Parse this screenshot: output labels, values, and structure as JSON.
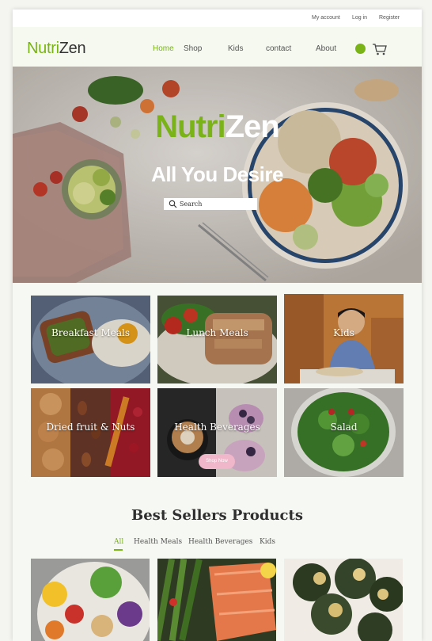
{
  "topbar": {
    "my_account": "My account",
    "login": "Log in",
    "register": "Register"
  },
  "brand": {
    "part1": "Nutri",
    "part2": "Zen"
  },
  "nav": {
    "home": "Home",
    "shop": "Shop",
    "kids": "Kids",
    "contact": "contact",
    "about": "About"
  },
  "hero": {
    "title_part1": "Nutri",
    "title_part2": "Zen",
    "subtitle": "All You Desire",
    "search_placeholder": "Search"
  },
  "categories": [
    {
      "label": "Breakfast Meals"
    },
    {
      "label": "Lunch Meals"
    },
    {
      "label": "Kids"
    },
    {
      "label": "Dried fruit & Nuts"
    },
    {
      "label": "Health Beverages",
      "button": "Shop Now"
    },
    {
      "label": "Salad"
    }
  ],
  "best_sellers": {
    "title": "Best Sellers Products",
    "filters": [
      "All",
      "Health Meals",
      "Health Beverages",
      "Kids"
    ]
  },
  "colors": {
    "brand_green": "#7ab317",
    "pink_button": "#f0b6c9"
  }
}
